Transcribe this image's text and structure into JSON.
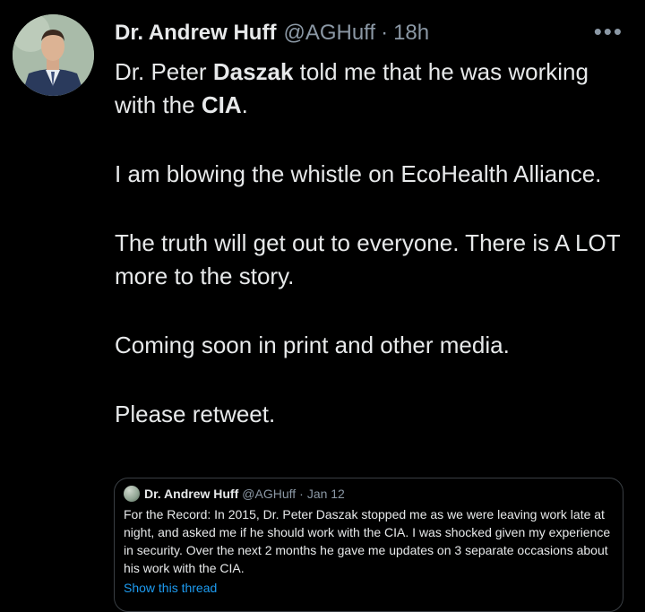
{
  "tweet": {
    "author_name": "Dr. Andrew Huff",
    "author_handle": "@AGHuff",
    "separator": "·",
    "time": "18h",
    "more_glyph": "•••",
    "paragraphs": [
      {
        "segments": [
          {
            "text": "Dr. Peter ",
            "bold": false
          },
          {
            "text": "Daszak",
            "bold": true
          },
          {
            "text": " told me that he was working with the ",
            "bold": false
          },
          {
            "text": "CIA",
            "bold": true
          },
          {
            "text": ".",
            "bold": false
          }
        ]
      },
      {
        "segments": [
          {
            "text": "I am blowing the whistle on EcoHealth Alliance.",
            "bold": false
          }
        ]
      },
      {
        "segments": [
          {
            "text": "The truth will get out to everyone. There is A LOT more to the story.",
            "bold": false
          }
        ]
      },
      {
        "segments": [
          {
            "text": "Coming soon in print and other media.",
            "bold": false
          }
        ]
      },
      {
        "segments": [
          {
            "text": "Please retweet.",
            "bold": false
          }
        ]
      }
    ]
  },
  "quoted_tweet": {
    "author_name": "Dr. Andrew Huff",
    "author_handle": "@AGHuff",
    "separator": "·",
    "time": "Jan 12",
    "text": "For the Record: In 2015, Dr. Peter Daszak stopped me as we were leaving work late at night, and asked me if he should work with the CIA. I was shocked given my experience in security. Over the next 2 months he gave me updates on 3 separate occasions about his work with the CIA.",
    "link_text": "Show this thread"
  },
  "icons": {
    "avatar": "profile-photo",
    "more": "more-options-icon"
  },
  "colors": {
    "background": "#000000",
    "text": "#e7e9ea",
    "muted": "#8b98a5",
    "link": "#1d9bf0",
    "border": "#3a3f44"
  }
}
